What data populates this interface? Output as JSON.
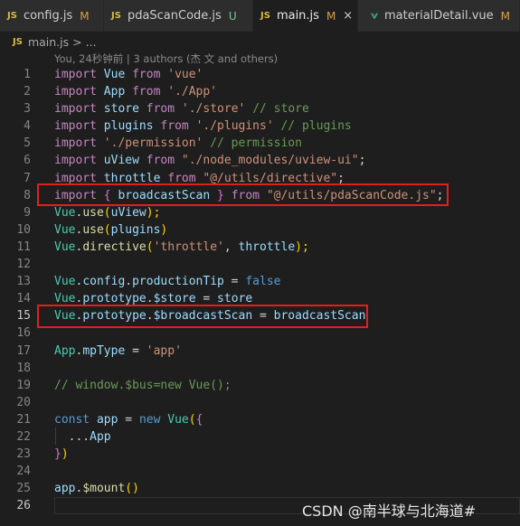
{
  "tabs": [
    {
      "icon": "JS",
      "name": "config.js",
      "status": "M",
      "active": false
    },
    {
      "icon": "JS",
      "name": "pdaScanCode.js",
      "status": "U",
      "active": false
    },
    {
      "icon": "JS",
      "name": "main.js",
      "status": "M",
      "active": true,
      "close": "×"
    },
    {
      "icon": "vue",
      "name": "materialDetail.vue",
      "status": "M",
      "active": false
    }
  ],
  "breadcrumb": {
    "icon": "JS",
    "file": "main.js",
    "sep": ">",
    "more": "..."
  },
  "blame": "You, 24秒钟前 | 3 authors (杰 文 and others)",
  "lines": [
    "1",
    "2",
    "3",
    "4",
    "5",
    "6",
    "7",
    "8",
    "9",
    "10",
    "11",
    "12",
    "13",
    "14",
    "15",
    "16",
    "17",
    "18",
    "19",
    "20",
    "21",
    "22",
    "23",
    "24",
    "25",
    "26"
  ],
  "code": {
    "l1": [
      "import",
      "Vue",
      "from",
      "'vue'"
    ],
    "l2": [
      "import",
      "App",
      "from",
      "'./App'"
    ],
    "l3": [
      "import",
      "store",
      "from",
      "'./store'",
      "// store"
    ],
    "l4": [
      "import",
      "plugins",
      "from",
      "'./plugins'",
      "// plugins"
    ],
    "l5": [
      "import",
      "'./permission'",
      "// permission"
    ],
    "l6": [
      "import",
      "uView",
      "from",
      "\"./node_modules/uview-ui\"",
      ";"
    ],
    "l7": [
      "import",
      "throttle",
      "from",
      "\"@/utils/directive\"",
      ";"
    ],
    "l8": [
      "import",
      "{",
      "broadcastScan",
      "}",
      "from",
      "\"@/utils/pdaScanCode.js\"",
      ";"
    ],
    "l9": [
      "Vue",
      ".",
      "use",
      "(",
      "uView",
      ");"
    ],
    "l10": [
      "Vue",
      ".",
      "use",
      "(",
      "plugins",
      ")"
    ],
    "l11": [
      "Vue",
      ".",
      "directive",
      "(",
      "'throttle'",
      ", ",
      "throttle",
      ");"
    ],
    "l13": [
      "Vue",
      ".",
      "config",
      ".",
      "productionTip",
      " = ",
      "false"
    ],
    "l14": [
      "Vue",
      ".",
      "prototype",
      ".",
      "$store",
      " = ",
      "store"
    ],
    "l15": [
      "Vue",
      ".",
      "prototype",
      ".",
      "$broadcastScan",
      " = ",
      "broadcastScan"
    ],
    "l17": [
      "App",
      ".",
      "mpType",
      " = ",
      "'app'"
    ],
    "l19": [
      "// window.$bus=new Vue();"
    ],
    "l21": [
      "const",
      "app",
      " = ",
      "new",
      "Vue",
      "(",
      "{"
    ],
    "l22": [
      "...App"
    ],
    "l23": [
      "}",
      ")"
    ],
    "l25": [
      "app",
      ".",
      "$mount",
      "()"
    ]
  },
  "watermark": "CSDN @南半球与北海道#",
  "colors": {
    "keyword": "#569cd6",
    "import": "#c586c0",
    "variable": "#9cdcfe",
    "string": "#ce9178",
    "function": "#dcdcaa",
    "comment": "#6a9955",
    "highlight_box": "#e0201f",
    "added_gutter": "#2ea043"
  }
}
